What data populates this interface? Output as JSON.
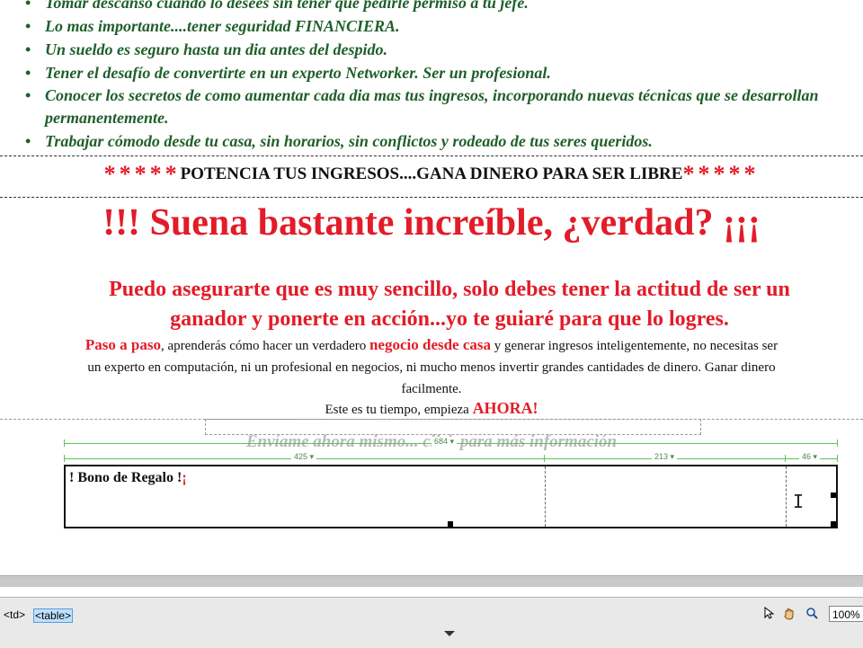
{
  "bullets": [
    "Tomar descanso cuando lo desees sin tener que pedirle permiso a tu jefe.",
    "Lo mas importante....tener seguridad FINANCIERA.",
    "Un sueldo es seguro hasta un dia antes del despido.",
    "Tener el desafío de convertirte en un experto Networker. Ser un profesional.",
    "Conocer los secretos de como aumentar cada dia mas tus ingresos, incorporando nuevas técnicas que se desarrollan permanentemente.",
    "Trabajar cómodo desde tu casa, sin horarios, sin conflictos y rodeado de tus seres queridos."
  ],
  "banner": {
    "stars_left": "*****",
    "text": "POTENCIA TUS INGRESOS....GANA DINERO PARA SER LIBRE",
    "stars_right": "*****"
  },
  "headline": "!!! Suena bastante increíble, ¿verdad? ¡¡¡",
  "subheadline": {
    "line1": "Puedo asegurarte que es muy sencillo, solo debes tener la actitud de ser un",
    "line2": "ganador y ponerte en acción...yo te guiaré para que lo logres."
  },
  "paragraph": {
    "paso": "Paso a paso",
    "part1": ", aprenderás cómo hacer un verdadero ",
    "negocio": "negocio desde casa",
    "part2": " y generar ingresos inteligentemente, no necesitas ser",
    "line2": "un experto en computación, ni un profesional en negocios, ni mucho menos invertir grandes cantidades de dinero. Ganar dinero",
    "line3": "facilmente."
  },
  "cta": {
    "text": "Este es tu tiempo, empieza ",
    "ahora": "AHORA!"
  },
  "design_view": {
    "ghost_text": "Envíame ahora mismo... click para más información",
    "table_width": "684",
    "col_widths": [
      "425",
      "213",
      "46"
    ],
    "cell_text": "! Bono de Regalo !",
    "cell_text_red": "¡"
  },
  "status_bar": {
    "tags": [
      "<td>",
      "<table>"
    ],
    "zoom": "100%"
  },
  "icons": [
    "select-arrow-icon",
    "hand-icon",
    "zoom-icon"
  ]
}
